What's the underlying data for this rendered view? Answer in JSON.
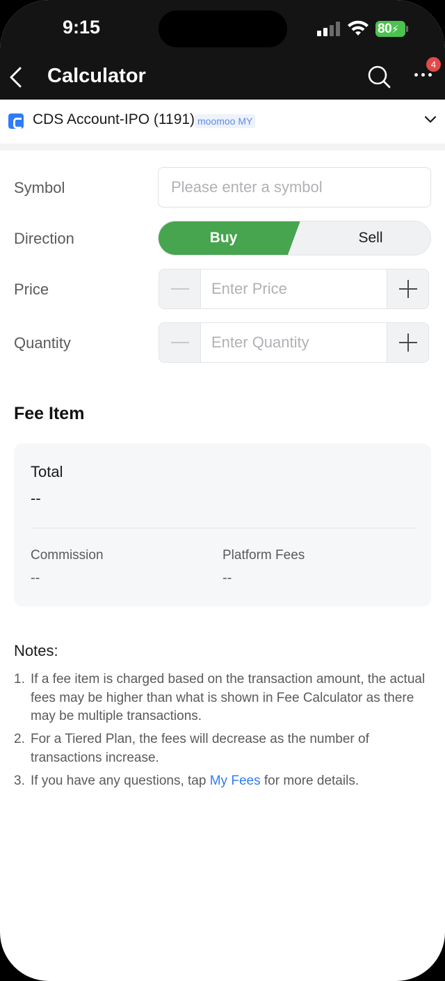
{
  "status_bar": {
    "time": "9:15",
    "battery": "80"
  },
  "nav": {
    "title": "Calculator",
    "notification_count": "4"
  },
  "account": {
    "name": "CDS Account-IPO (1191)",
    "broker_tag": "moomoo MY"
  },
  "form": {
    "symbol_label": "Symbol",
    "symbol_placeholder": "Please enter a symbol",
    "direction_label": "Direction",
    "buy_label": "Buy",
    "sell_label": "Sell",
    "price_label": "Price",
    "price_placeholder": "Enter Price",
    "quantity_label": "Quantity",
    "quantity_placeholder": "Enter Quantity"
  },
  "fee": {
    "section_title": "Fee Item",
    "total_label": "Total",
    "total_value": "--",
    "commission_label": "Commission",
    "commission_value": "--",
    "platform_label": "Platform Fees",
    "platform_value": "--"
  },
  "notes": {
    "title": "Notes:",
    "items": [
      {
        "num": "1.",
        "text": "If a fee item is charged based on the transaction amount, the actual fees may be higher than what is shown in Fee Calculator as there may be multiple transactions."
      },
      {
        "num": "2.",
        "text": "For a Tiered Plan, the fees will decrease as the number of transactions increase."
      },
      {
        "num": "3.",
        "pre": "If you have any questions, tap ",
        "link": "My Fees",
        "post": " for more details."
      }
    ]
  },
  "colors": {
    "buy_green": "#46a54e",
    "link_blue": "#2f7cf6",
    "badge_red": "#e24a4a"
  }
}
